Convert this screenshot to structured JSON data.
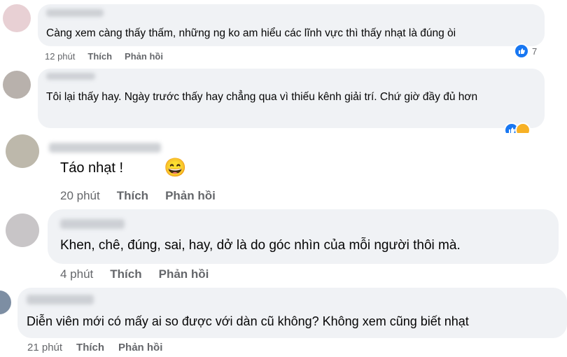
{
  "comments": [
    {
      "text": "Càng xem càng thấy thấm, những ng ko am hiểu các lĩnh vực thì thấy nhạt là đúng òi",
      "time": "12 phút",
      "like_label": "Thích",
      "reply_label": "Phản hồi",
      "reaction_count": "7",
      "reactions": [
        "like-icon"
      ]
    },
    {
      "text": "Tôi lại thấy hay. Ngày trước thấy hay chẳng qua vì thiếu kênh giải trí. Chứ giờ đầy đủ hơn",
      "reactions": [
        "like-icon",
        "haha-icon"
      ]
    },
    {
      "text": "Táo nhạt !",
      "emoji": "😄",
      "time": "20 phút",
      "like_label": "Thích",
      "reply_label": "Phản hồi"
    },
    {
      "text": "Khen, chê, đúng, sai, hay, dở là do góc nhìn của mỗi người thôi mà.",
      "time": "4 phút",
      "like_label": "Thích",
      "reply_label": "Phản hồi"
    },
    {
      "text": "Diễn viên mới có mấy ai so được với dàn cũ không? Không xem cũng biết nhạt",
      "time": "21 phút",
      "like_label": "Thích",
      "reply_label": "Phản hồi"
    }
  ],
  "colors": {
    "bubble": "#f0f2f5",
    "meta_text": "#65676b",
    "like_blue": "#1877f2",
    "haha_yellow": "#f7b125"
  }
}
